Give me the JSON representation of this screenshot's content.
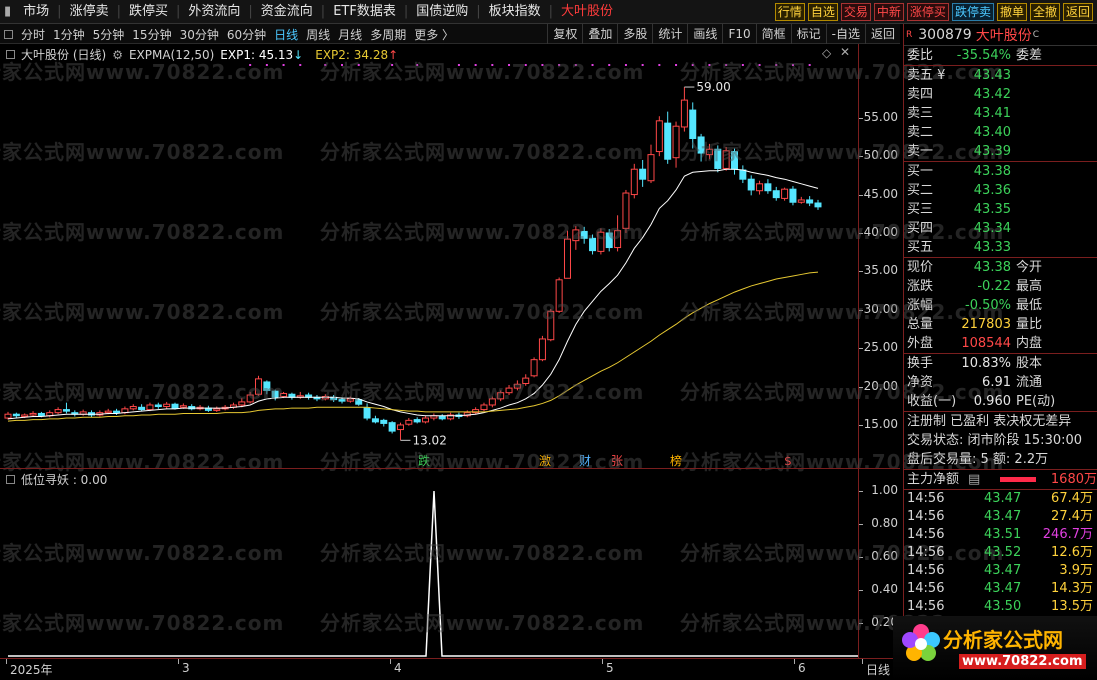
{
  "menu": [
    {
      "label": "市场"
    },
    {
      "label": "涨停卖"
    },
    {
      "label": "跌停买"
    },
    {
      "label": "外资流向"
    },
    {
      "label": "资金流向"
    },
    {
      "label": "ETF数据表"
    },
    {
      "label": "国债逆购"
    },
    {
      "label": "板块指数"
    },
    {
      "label": "大叶股份",
      "active": true
    }
  ],
  "right_buttons": [
    {
      "label": "行情",
      "style": "yellow"
    },
    {
      "label": "自选",
      "style": "yellow"
    },
    {
      "label": "交易",
      "style": "red"
    },
    {
      "label": "中新",
      "style": "red"
    },
    {
      "label": "涨停买",
      "style": "red"
    },
    {
      "label": "跌停卖",
      "style": "blue"
    },
    {
      "label": "撤单",
      "style": "yellow"
    },
    {
      "label": "全撤",
      "style": "yellow"
    },
    {
      "label": "返回",
      "style": "yellow"
    }
  ],
  "periods": [
    "分时",
    "1分钟",
    "5分钟",
    "15分钟",
    "30分钟",
    "60分钟",
    "日线",
    "周线",
    "月线",
    "多周期",
    "更多 〉"
  ],
  "selected_period": "日线",
  "tools": [
    "复权",
    "叠加",
    "多股",
    "统计",
    "画线",
    "F10",
    "简框",
    "标记",
    "-自选",
    "返回"
  ],
  "main_legend": {
    "stock": "大叶股份 (日线)",
    "indicator": "EXPMA(12,50)",
    "exp1": "EXP1: 45.13",
    "exp1_arrow": "↓",
    "exp2": "EXP2: 34.28",
    "exp2_arrow": "↑"
  },
  "sub_legend": {
    "name": "低位寻妖 : 0.00"
  },
  "watermark": "分析家公式网www.70822.com",
  "annotations": {
    "high": "59.00",
    "low": "13.02"
  },
  "event_markers": [
    "跌",
    "激",
    "财",
    "张",
    "榜",
    "$"
  ],
  "time_axis": [
    {
      "label": "2025年",
      "x": 10
    },
    {
      "label": "3",
      "x": 182
    },
    {
      "label": "4",
      "x": 394
    },
    {
      "label": "5",
      "x": 606
    },
    {
      "label": "6",
      "x": 798
    },
    {
      "label": "日线",
      "x": 866
    }
  ],
  "colors": {
    "up": "#ff4848",
    "down": "#54e6ff",
    "exp1": "#ffffff",
    "exp2": "#e6c832",
    "frame": "#7a1e1e"
  },
  "chart_data": [
    {
      "type": "candlestick",
      "title": "大叶股份 (日线)",
      "ylim": [
        12,
        62
      ],
      "yticks": [
        15.0,
        20.0,
        25.0,
        30.0,
        35.0,
        40.0,
        45.0,
        50.0,
        55.0
      ],
      "candles": [
        [
          15.9,
          16.4,
          16.7,
          15.7
        ],
        [
          16.4,
          16.2,
          16.6,
          15.9
        ],
        [
          16.1,
          16.3,
          16.5,
          15.9
        ],
        [
          16.3,
          16.5,
          16.8,
          16.1
        ],
        [
          16.5,
          16.2,
          16.7,
          16.0
        ],
        [
          16.2,
          16.6,
          16.9,
          16.0
        ],
        [
          16.6,
          17.0,
          17.3,
          16.4
        ],
        [
          17.0,
          16.8,
          17.9,
          16.5
        ],
        [
          16.6,
          16.4,
          16.9,
          16.1
        ],
        [
          16.4,
          16.7,
          17.0,
          16.2
        ],
        [
          16.6,
          16.3,
          16.9,
          16.0
        ],
        [
          16.3,
          16.6,
          16.9,
          16.1
        ],
        [
          16.6,
          16.8,
          17.1,
          16.4
        ],
        [
          16.8,
          16.6,
          17.1,
          16.3
        ],
        [
          16.6,
          17.1,
          17.4,
          16.4
        ],
        [
          17.1,
          17.4,
          17.7,
          16.9
        ],
        [
          17.3,
          17.0,
          17.7,
          16.8
        ],
        [
          17.0,
          17.6,
          17.9,
          16.8
        ],
        [
          17.6,
          17.4,
          17.9,
          17.1
        ],
        [
          17.4,
          17.7,
          18.0,
          17.1
        ],
        [
          17.7,
          17.2,
          17.9,
          17.0
        ],
        [
          17.3,
          17.5,
          17.8,
          17.1
        ],
        [
          17.4,
          17.1,
          17.7,
          16.9
        ],
        [
          17.1,
          17.3,
          17.6,
          16.9
        ],
        [
          17.2,
          16.9,
          17.5,
          16.7
        ],
        [
          16.9,
          17.1,
          17.4,
          16.7
        ],
        [
          17.1,
          17.3,
          17.6,
          16.9
        ],
        [
          17.3,
          17.6,
          17.9,
          17.1
        ],
        [
          17.6,
          18.0,
          18.5,
          17.3
        ],
        [
          18.0,
          18.9,
          19.3,
          17.8
        ],
        [
          19.0,
          21.0,
          21.4,
          18.8
        ],
        [
          20.6,
          19.5,
          20.8,
          19.0
        ],
        [
          19.4,
          18.6,
          19.6,
          18.2
        ],
        [
          18.7,
          19.1,
          19.3,
          18.5
        ],
        [
          19.0,
          18.6,
          19.2,
          18.3
        ],
        [
          18.6,
          18.8,
          19.3,
          18.4
        ],
        [
          18.9,
          18.6,
          19.2,
          18.3
        ],
        [
          18.6,
          18.4,
          18.9,
          18.1
        ],
        [
          18.4,
          18.7,
          19.0,
          18.2
        ],
        [
          18.6,
          18.3,
          18.9,
          18.0
        ],
        [
          18.3,
          18.1,
          18.6,
          17.8
        ],
        [
          18.1,
          18.4,
          18.7,
          17.9
        ],
        [
          18.3,
          17.7,
          18.5,
          17.5
        ],
        [
          17.2,
          15.9,
          17.8,
          15.6
        ],
        [
          15.8,
          15.4,
          16.2,
          15.2
        ],
        [
          15.6,
          15.2,
          15.8,
          14.8
        ],
        [
          15.3,
          14.2,
          15.5,
          13.9
        ],
        [
          14.4,
          15.0,
          15.3,
          13.0
        ],
        [
          15.1,
          15.6,
          15.9,
          14.9
        ],
        [
          15.7,
          15.4,
          16.0,
          15.2
        ],
        [
          15.4,
          15.9,
          16.2,
          15.2
        ],
        [
          15.9,
          16.2,
          16.5,
          15.6
        ],
        [
          16.1,
          15.8,
          16.4,
          15.6
        ],
        [
          15.8,
          16.3,
          16.6,
          15.6
        ],
        [
          16.3,
          16.1,
          16.6,
          15.8
        ],
        [
          16.2,
          16.6,
          16.9,
          16.0
        ],
        [
          16.6,
          17.0,
          17.3,
          16.4
        ],
        [
          17.0,
          17.6,
          17.9,
          16.8
        ],
        [
          17.6,
          18.4,
          18.7,
          17.3
        ],
        [
          18.4,
          19.2,
          19.5,
          18.1
        ],
        [
          19.2,
          19.8,
          20.2,
          18.9
        ],
        [
          19.8,
          20.3,
          20.8,
          19.5
        ],
        [
          20.4,
          21.1,
          21.6,
          20.1
        ],
        [
          21.4,
          23.5,
          23.8,
          21.2
        ],
        [
          23.5,
          26.2,
          26.6,
          23.3
        ],
        [
          26.1,
          29.8,
          30.1,
          25.9
        ],
        [
          29.8,
          33.9,
          34.2,
          29.6
        ],
        [
          34.1,
          39.2,
          40.3,
          35.7
        ],
        [
          39.0,
          40.4,
          40.9,
          37.8
        ],
        [
          40.2,
          39.3,
          40.8,
          38.6
        ],
        [
          39.3,
          37.7,
          39.8,
          37.2
        ],
        [
          37.6,
          40.1,
          40.6,
          37.2
        ],
        [
          40.0,
          38.1,
          40.5,
          37.6
        ],
        [
          38.1,
          40.3,
          42.3,
          37.6
        ],
        [
          40.6,
          45.2,
          45.6,
          40.0
        ],
        [
          45.0,
          48.3,
          49.0,
          44.5
        ],
        [
          48.3,
          47.0,
          49.5,
          46.0
        ],
        [
          46.8,
          50.2,
          51.5,
          46.5
        ],
        [
          50.6,
          54.6,
          55.2,
          50.0
        ],
        [
          54.3,
          49.6,
          55.8,
          49.0
        ],
        [
          49.8,
          53.9,
          54.5,
          48.5
        ],
        [
          53.8,
          57.3,
          59.0,
          53.2
        ],
        [
          56.0,
          52.3,
          57.0,
          51.0
        ],
        [
          52.5,
          50.4,
          52.9,
          49.3
        ],
        [
          50.2,
          50.9,
          51.6,
          49.6
        ],
        [
          50.9,
          48.4,
          51.4,
          47.9
        ],
        [
          48.4,
          50.7,
          51.2,
          48.1
        ],
        [
          50.6,
          48.3,
          51.0,
          47.6
        ],
        [
          48.2,
          47.0,
          48.8,
          46.5
        ],
        [
          47.0,
          45.6,
          47.5,
          44.9
        ],
        [
          45.5,
          46.4,
          46.8,
          45.0
        ],
        [
          46.4,
          45.5,
          47.0,
          45.1
        ],
        [
          45.5,
          44.6,
          46.0,
          44.2
        ],
        [
          44.5,
          45.7,
          45.9,
          44.2
        ],
        [
          45.7,
          44.0,
          46.1,
          43.6
        ],
        [
          44.0,
          44.3,
          44.7,
          43.8
        ],
        [
          44.3,
          43.9,
          44.8,
          43.5
        ],
        [
          43.9,
          43.4,
          44.3,
          43.0
        ]
      ],
      "series": [
        {
          "name": "EXP1",
          "values": [
            15.8,
            15.9,
            16.0,
            16.1,
            16.1,
            16.2,
            16.3,
            16.4,
            16.4,
            16.4,
            16.4,
            16.4,
            16.5,
            16.5,
            16.6,
            16.7,
            16.8,
            16.9,
            17.0,
            17.1,
            17.1,
            17.2,
            17.2,
            17.2,
            17.2,
            17.2,
            17.2,
            17.3,
            17.4,
            17.6,
            18.1,
            18.4,
            18.5,
            18.6,
            18.6,
            18.6,
            18.6,
            18.6,
            18.6,
            18.6,
            18.5,
            18.5,
            18.4,
            18.0,
            17.7,
            17.4,
            17.0,
            16.7,
            16.5,
            16.3,
            16.2,
            16.2,
            16.2,
            16.2,
            16.2,
            16.3,
            16.4,
            16.6,
            16.9,
            17.2,
            17.6,
            17.9,
            18.4,
            19.1,
            20.2,
            21.6,
            23.5,
            25.9,
            28.1,
            29.8,
            31.1,
            32.4,
            33.4,
            34.5,
            36.1,
            38.0,
            39.4,
            41.1,
            43.2,
            44.2,
            45.6,
            47.4,
            47.9,
            48.0,
            48.1,
            48.1,
            48.3,
            48.3,
            48.2,
            47.9,
            47.7,
            47.5,
            47.2,
            47.0,
            46.7,
            46.4,
            46.1,
            45.8
          ]
        },
        {
          "name": "EXP2",
          "values": [
            15.5,
            15.6,
            15.6,
            15.7,
            15.7,
            15.8,
            15.8,
            15.9,
            15.9,
            16.0,
            16.0,
            16.0,
            16.1,
            16.1,
            16.2,
            16.2,
            16.3,
            16.3,
            16.4,
            16.4,
            16.4,
            16.5,
            16.5,
            16.5,
            16.5,
            16.5,
            16.6,
            16.6,
            16.6,
            16.7,
            16.9,
            17.0,
            17.1,
            17.1,
            17.2,
            17.2,
            17.2,
            17.3,
            17.3,
            17.3,
            17.3,
            17.3,
            17.3,
            17.3,
            17.2,
            17.1,
            17.0,
            16.9,
            16.8,
            16.8,
            16.7,
            16.7,
            16.7,
            16.7,
            16.7,
            16.7,
            16.7,
            16.7,
            16.8,
            16.9,
            17.0,
            17.1,
            17.3,
            17.5,
            17.8,
            18.2,
            18.8,
            19.5,
            20.2,
            20.8,
            21.4,
            22.0,
            22.5,
            23.1,
            23.8,
            24.5,
            25.2,
            25.9,
            26.7,
            27.4,
            28.1,
            28.9,
            29.6,
            30.2,
            30.8,
            31.3,
            31.8,
            32.3,
            32.7,
            33.1,
            33.4,
            33.7,
            34.0,
            34.2,
            34.4,
            34.6,
            34.8,
            34.9
          ]
        }
      ]
    },
    {
      "type": "line",
      "title": "低位寻妖",
      "ylim": [
        0,
        1
      ],
      "yticks": [
        0.2,
        0.4,
        0.6,
        0.8,
        1.0
      ],
      "series": [
        {
          "name": "低位寻妖",
          "spike_index": 47,
          "spike_value": 1.0,
          "values_baseline": 0.0
        }
      ]
    }
  ],
  "quote": {
    "r_badge": "R",
    "code": "300879",
    "name": "大叶股份",
    "sup": "C",
    "weibi_label": "委比",
    "weibi_value": "-35.54%",
    "weicha_label": "委差",
    "sells": [
      {
        "label": "卖五",
        "mark": "¥",
        "price": "43.43"
      },
      {
        "label": "卖四",
        "price": "43.42"
      },
      {
        "label": "卖三",
        "price": "43.41"
      },
      {
        "label": "卖二",
        "price": "43.40"
      },
      {
        "label": "卖一",
        "price": "43.39"
      }
    ],
    "buys": [
      {
        "label": "买一",
        "price": "43.38"
      },
      {
        "label": "买二",
        "price": "43.36"
      },
      {
        "label": "买三",
        "price": "43.35"
      },
      {
        "label": "买四",
        "price": "43.34"
      },
      {
        "label": "买五",
        "price": "43.33"
      }
    ],
    "stats1": [
      {
        "l": "现价",
        "v": "43.38",
        "c": "green",
        "l2": "今开"
      },
      {
        "l": "涨跌",
        "v": "-0.22",
        "c": "green",
        "l2": "最高"
      },
      {
        "l": "涨幅",
        "v": "-0.50%",
        "c": "green",
        "l2": "最低"
      },
      {
        "l": "总量",
        "v": "217803",
        "c": "yellow",
        "l2": "量比"
      },
      {
        "l": "外盘",
        "v": "108544",
        "c": "red",
        "l2": "内盘"
      }
    ],
    "stats2": [
      {
        "l": "换手",
        "v": "10.83%",
        "c": "white",
        "l2": "股本"
      },
      {
        "l": "净资",
        "v": "6.91",
        "c": "white",
        "l2": "流通"
      },
      {
        "l": "收益(一)",
        "v": "0.960",
        "c": "white",
        "l2": "PE(动)"
      }
    ],
    "lines": [
      "注册制 已盈利 表决权无差异",
      "交易状态: 闭市阶段 15:30:00",
      "盘后交易量: 5  额: 2.2万"
    ],
    "main_flow_label": "主力净额",
    "main_flow_value": "1680万",
    "ticks": [
      {
        "t": "14:56",
        "p": "43.47",
        "pc": "green",
        "v": "67.4万",
        "vc": "yellow"
      },
      {
        "t": "14:56",
        "p": "43.47",
        "pc": "green",
        "v": "27.4万",
        "vc": "yellow"
      },
      {
        "t": "14:56",
        "p": "43.51",
        "pc": "green",
        "v": "246.7万",
        "vc": "purple"
      },
      {
        "t": "14:56",
        "p": "43.52",
        "pc": "green",
        "v": "12.6万",
        "vc": "yellow"
      },
      {
        "t": "14:56",
        "p": "43.47",
        "pc": "green",
        "v": "3.9万",
        "vc": "yellow"
      },
      {
        "t": "14:56",
        "p": "43.47",
        "pc": "green",
        "v": "14.3万",
        "vc": "yellow"
      },
      {
        "t": "14:56",
        "p": "43.50",
        "pc": "green",
        "v": "13.5万",
        "vc": "yellow"
      }
    ]
  },
  "logo": {
    "brand": "分析家公式网",
    "url": "www.70822.com"
  }
}
